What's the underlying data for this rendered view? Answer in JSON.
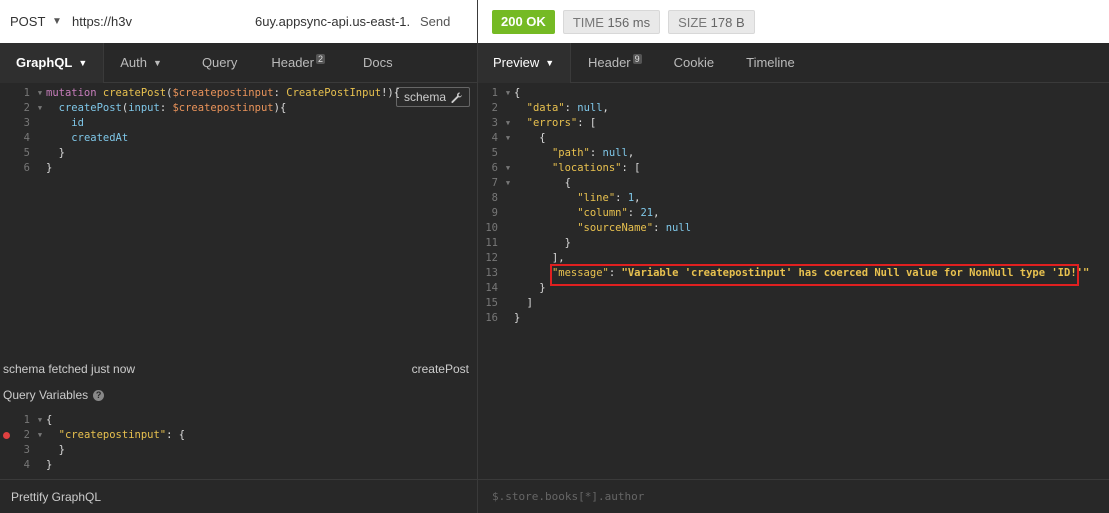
{
  "request": {
    "method": "POST",
    "url_start": "https://h3v",
    "url_end": "6uy.appsync-api.us-east-1.",
    "send_label": "Send"
  },
  "response_status": {
    "status": "200 OK",
    "time_label": "TIME",
    "time_value": "156 ms",
    "size_label": "SIZE",
    "size_value": "178 B"
  },
  "left_tabs": [
    {
      "label": "GraphQL"
    },
    {
      "label": "Auth"
    },
    {
      "label": "Query"
    },
    {
      "label": "Header",
      "count": "2"
    },
    {
      "label": "Docs"
    }
  ],
  "right_tabs": [
    {
      "label": "Preview"
    },
    {
      "label": "Header",
      "count": "9"
    },
    {
      "label": "Cookie"
    },
    {
      "label": "Timeline"
    }
  ],
  "schema_button": "schema",
  "query_editor": {
    "line1": {
      "mutation": "mutation",
      "name": "createPost",
      "var": "$createpostinput",
      "sep": ": ",
      "type": "CreatePostInput",
      "tail": "!){"
    },
    "line2": {
      "field": "createPost",
      "arg": "input",
      "var": "$createpostinput",
      "tail": "){"
    },
    "line3": "id",
    "line4": "createdAt",
    "line5": "}",
    "line6": "}"
  },
  "schema_status": {
    "left": "schema fetched just now",
    "right": "createPost"
  },
  "query_variables": {
    "label": "Query Variables",
    "line1": "{",
    "line2_key": "\"createpostinput\"",
    "line2_tail": ": {",
    "line3": "}",
    "line4": "}"
  },
  "response": {
    "data_key": "\"data\"",
    "errors_key": "\"errors\"",
    "path_key": "\"path\"",
    "locations_key": "\"locations\"",
    "line_key": "\"line\"",
    "line_val": "1",
    "column_key": "\"column\"",
    "column_val": "21",
    "sourceName_key": "\"sourceName\"",
    "message_key": "\"message\"",
    "message_val": "\"Variable 'createpostinput' has coerced Null value for NonNull type 'ID!'\"",
    "null": "null"
  },
  "prettify_label": "Prettify GraphQL",
  "filter_placeholder": "$.store.books[*].author",
  "colors": {
    "ok_badge": "#75ba24",
    "highlight_border": "#e02020"
  }
}
